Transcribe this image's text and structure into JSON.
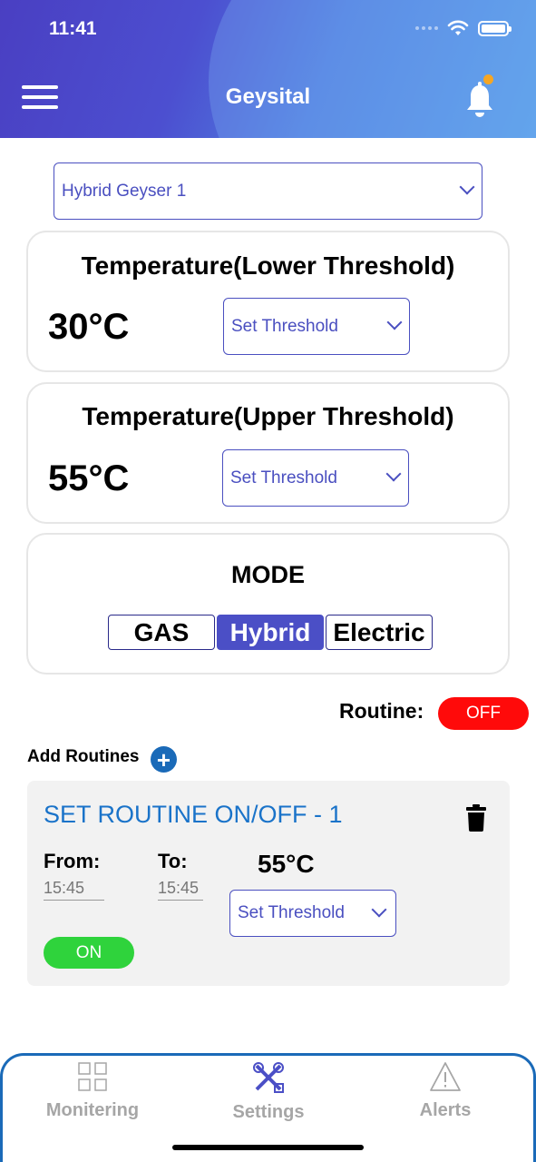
{
  "status_bar": {
    "time": "11:41"
  },
  "header": {
    "title": "Geysital"
  },
  "device_select": {
    "value": "Hybrid Geyser 1"
  },
  "lower_threshold": {
    "title": "Temperature(Lower Threshold)",
    "value": "30°C",
    "select_label": "Set Threshold"
  },
  "upper_threshold": {
    "title": "Temperature(Upper Threshold)",
    "value": "55°C",
    "select_label": "Set Threshold"
  },
  "mode": {
    "title": "MODE",
    "options": [
      "GAS",
      "Hybrid",
      "Electric"
    ],
    "selected": "Hybrid"
  },
  "routine": {
    "label": "Routine:",
    "toggle": "OFF"
  },
  "add_routines": {
    "label": "Add Routines",
    "icon": "+"
  },
  "routine_card": {
    "title": "SET ROUTINE ON/OFF - 1",
    "from_label": "From:",
    "to_label": "To:",
    "from_time": "15:45",
    "to_time": "15:45",
    "temperature": "55°C",
    "select_label": "Set Threshold",
    "toggle": "ON"
  },
  "tabs": [
    {
      "label": "Monitering",
      "icon": "grid-icon"
    },
    {
      "label": "Settings",
      "icon": "tools-icon"
    },
    {
      "label": "Alerts",
      "icon": "warning-icon"
    }
  ],
  "colors": {
    "accent": "#4b4fc6",
    "off": "#ff0a0a",
    "on": "#2fd33c",
    "link": "#1a73c9",
    "tab_border": "#1a6ab8"
  }
}
